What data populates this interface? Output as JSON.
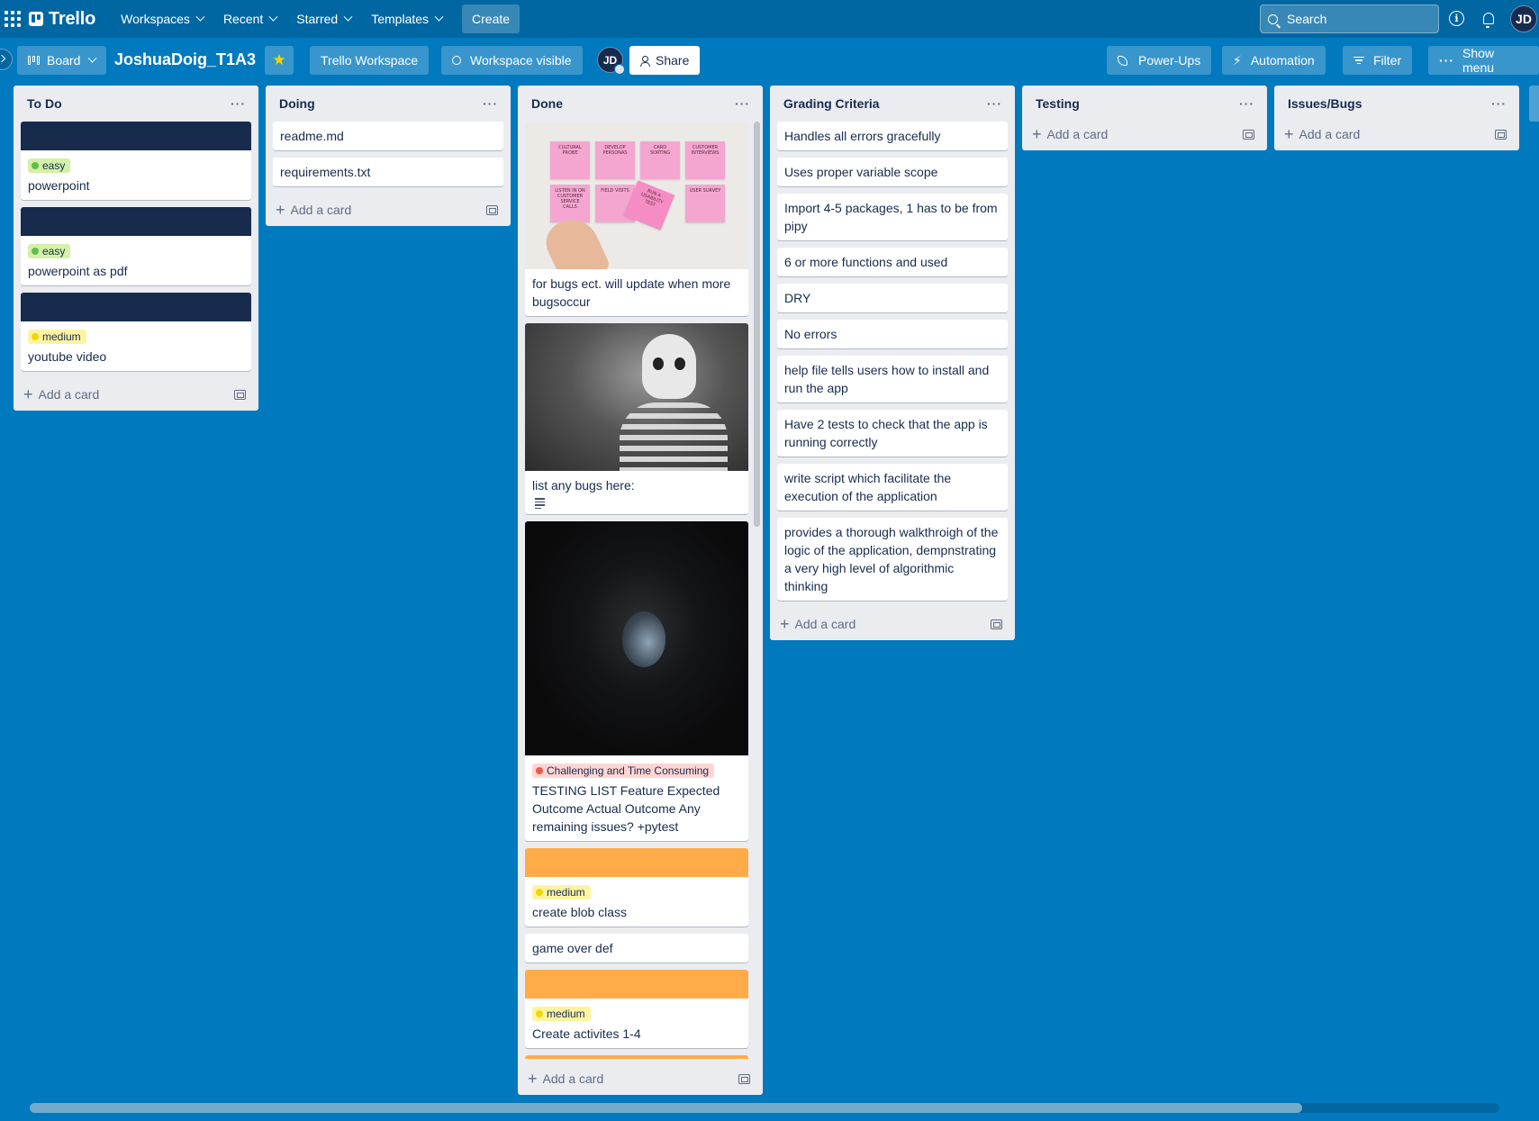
{
  "topnav": {
    "logo": "Trello",
    "menus": [
      "Workspaces",
      "Recent",
      "Starred",
      "Templates"
    ],
    "create_label": "Create",
    "search_label": "Search",
    "avatar": "JD",
    "info_glyph": "i"
  },
  "board": {
    "view_label": "Board",
    "title": "JoshuaDoig_T1A3",
    "workspace_label": "Trello Workspace",
    "visibility_label": "Workspace visible",
    "member_avatar": "JD",
    "share_label": "Share",
    "powerups_label": "Power-Ups",
    "automation_label": "Automation",
    "filter_label": "Filter",
    "show_menu_label": "Show menu",
    "star_color": "#f2d600"
  },
  "add_card_label": "Add a card",
  "colors": {
    "background": "#0079bf",
    "topnav": "#0067a3",
    "cover_navy": "#172b4d",
    "cover_orange": "#ffab4a"
  },
  "lists": {
    "todo": {
      "title": "To Do",
      "cards": [
        {
          "label": "easy",
          "text": "powerpoint"
        },
        {
          "label": "easy",
          "text": "powerpoint as pdf"
        },
        {
          "label": "medium",
          "text": "youtube video"
        }
      ]
    },
    "doing": {
      "title": "Doing",
      "cards": [
        "readme.md",
        "requirements.txt"
      ]
    },
    "done": {
      "title": "Done",
      "cards": [
        {
          "text": "for bugs ect. will update when more bugsoccur",
          "cover": "sticky-notes-photo",
          "notes": [
            "CULTURAL PROBE",
            "DEVELOP PERSONAS",
            "CARD SORTING",
            "CUSTOMER INTERVIEWS",
            "LISTEN IN ON CUSTOMER SERVICE CALLS",
            "FIELD VISITS",
            "RUN A USABILITY TEST",
            "USER SURVEY"
          ]
        },
        {
          "text": "list any bugs here:",
          "cover": "skeleton-photo"
        },
        {
          "label": "Challenging and Time Consuming",
          "text": "TESTING LIST Feature Expected Outcome Actual Outcome Any remaining issues? +pytest",
          "cover": "thinking-man-photo"
        },
        {
          "label": "medium",
          "text": "create blob class"
        },
        {
          "text": "game over def"
        },
        {
          "label": "medium",
          "text": "Create activites 1-4"
        }
      ]
    },
    "grading": {
      "title": "Grading Criteria",
      "cards": [
        "Handles all errors gracefully",
        "Uses proper variable scope",
        "Import 4-5 packages, 1 has to be from pipy",
        "6 or more functions and used",
        "DRY",
        "No errors",
        "help file tells users how to install and run the app",
        "Have 2 tests to check that the app is running correctly",
        "write script which facilitate the execution of the application",
        "provides a thorough walkthroigh of the logic of the application, dempnstrating a very high level of algorithmic thinking"
      ]
    },
    "testing": {
      "title": "Testing"
    },
    "issues": {
      "title": "Issues/Bugs"
    }
  }
}
